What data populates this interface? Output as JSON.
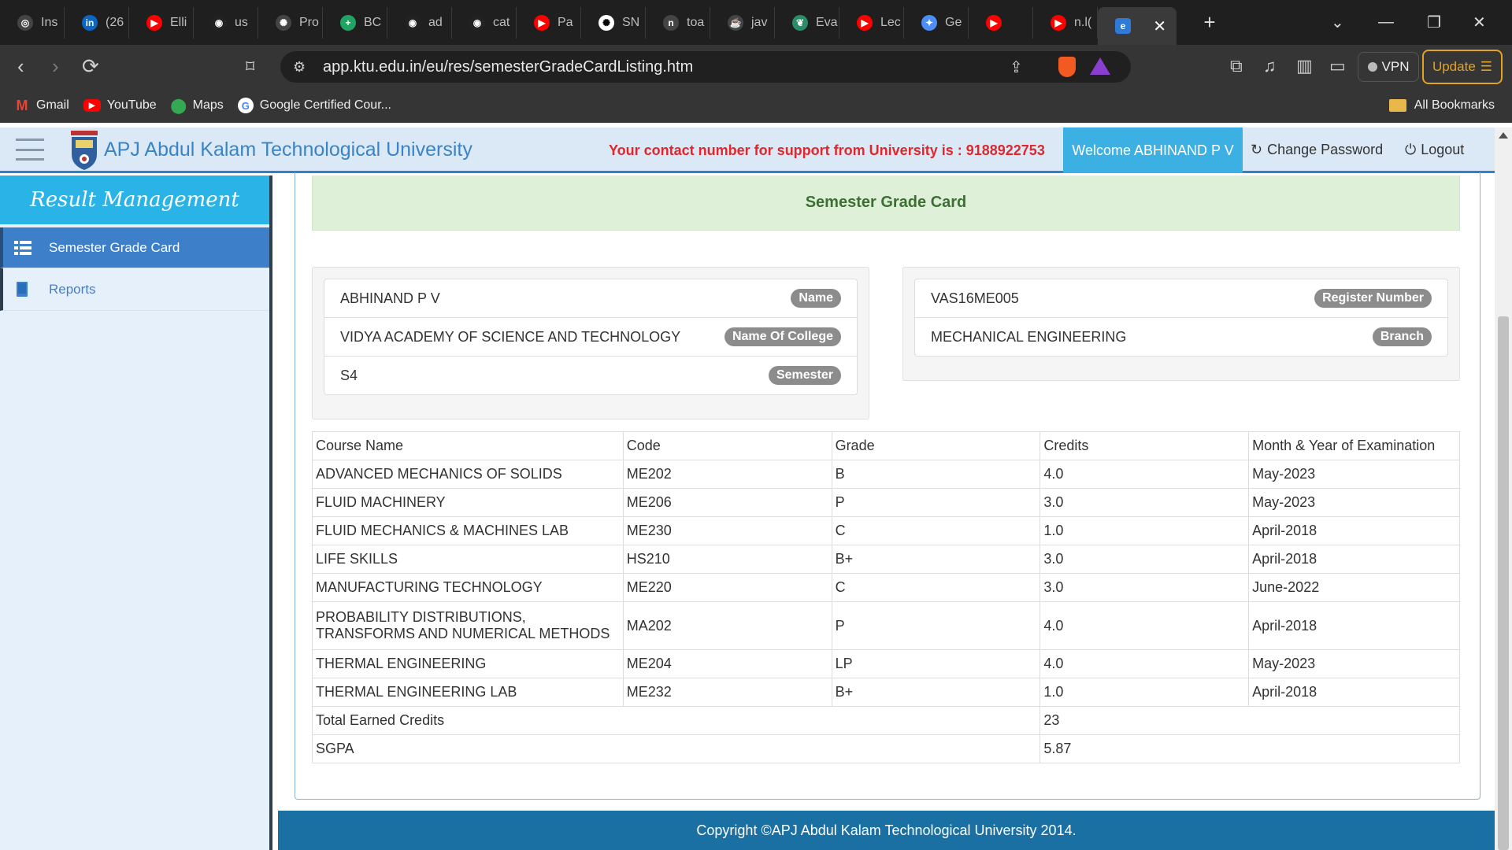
{
  "browser": {
    "tabs": [
      {
        "label": "Ins",
        "icon": "instagram-icon",
        "color": "#444"
      },
      {
        "label": "(26",
        "icon": "linkedin-icon",
        "color": "#0a66c2"
      },
      {
        "label": "Elli",
        "icon": "youtube-icon",
        "color": "#ff0000"
      },
      {
        "label": "us",
        "icon": "github-icon",
        "color": "#222"
      },
      {
        "label": "Pro",
        "icon": "openai-icon",
        "color": "#444"
      },
      {
        "label": "BC",
        "icon": "plus-icon",
        "color": "#1fa463"
      },
      {
        "label": "ad",
        "icon": "github-icon",
        "color": "#222"
      },
      {
        "label": "cat",
        "icon": "github-icon",
        "color": "#222"
      },
      {
        "label": "Pa",
        "icon": "youtube-icon",
        "color": "#ff0000"
      },
      {
        "label": "SN",
        "icon": "openai-icon",
        "color": "#fff"
      },
      {
        "label": "toa",
        "icon": "n-icon",
        "color": "#444"
      },
      {
        "label": "jav",
        "icon": "java-icon",
        "color": "#444"
      },
      {
        "label": "Eva",
        "icon": "leaf-icon",
        "color": "#2c8c6a"
      },
      {
        "label": "Lec",
        "icon": "youtube-icon",
        "color": "#ff0000"
      },
      {
        "label": "Ge",
        "icon": "gemini-icon",
        "color": "#4b8ef7"
      },
      {
        "label": "",
        "icon": "youtube-icon",
        "color": "#ff0000"
      },
      {
        "label": "n.l(",
        "icon": "youtube-icon",
        "color": "#ff0000"
      }
    ],
    "active_tab": {
      "icon": "edge-icon",
      "close": "✕"
    },
    "new_tab": "+",
    "url": "app.ktu.edu.in/eu/res/semesterGradeCardListing.htm",
    "vpn_label": "VPN",
    "update_label": "Update",
    "bookmarks": [
      {
        "label": "Gmail",
        "icon": "gmail-icon"
      },
      {
        "label": "YouTube",
        "icon": "youtube-icon"
      },
      {
        "label": "Maps",
        "icon": "maps-icon"
      },
      {
        "label": "Google Certified Cour...",
        "icon": "google-icon"
      }
    ],
    "all_bookmarks": "All Bookmarks"
  },
  "header": {
    "title": "APJ Abdul Kalam Technological University",
    "support": "Your contact number for support from University is : 9188922753",
    "welcome": "Welcome ABHINAND P V",
    "change_password": "Change Password",
    "logout": "Logout"
  },
  "sidebar": {
    "brand": "Result Management",
    "items": [
      {
        "label": "Semester Grade Card",
        "icon": "list-icon",
        "active": true
      },
      {
        "label": "Reports",
        "icon": "book-icon",
        "active": false
      }
    ]
  },
  "page": {
    "title": "Semester Grade Card",
    "student": {
      "name": "ABHINAND P V",
      "name_label": "Name",
      "college": "VIDYA ACADEMY OF SCIENCE AND TECHNOLOGY",
      "college_label": "Name Of College",
      "semester": "S4",
      "semester_label": "Semester",
      "register_number": "VAS16ME005",
      "register_label": "Register Number",
      "branch": "MECHANICAL ENGINEERING",
      "branch_label": "Branch"
    },
    "table": {
      "headers": [
        "Course Name",
        "Code",
        "Grade",
        "Credits",
        "Month & Year of Examination"
      ],
      "rows": [
        [
          "ADVANCED MECHANICS OF SOLIDS",
          "ME202",
          "B",
          "4.0",
          "May-2023"
        ],
        [
          "FLUID MACHINERY",
          "ME206",
          "P",
          "3.0",
          "May-2023"
        ],
        [
          "FLUID MECHANICS & MACHINES LAB",
          "ME230",
          "C",
          "1.0",
          "April-2018"
        ],
        [
          "LIFE SKILLS",
          "HS210",
          "B+",
          "3.0",
          "April-2018"
        ],
        [
          "MANUFACTURING TECHNOLOGY",
          "ME220",
          "C",
          "3.0",
          "June-2022"
        ],
        [
          "PROBABILITY DISTRIBUTIONS, TRANSFORMS AND NUMERICAL METHODS",
          "MA202",
          "P",
          "4.0",
          "April-2018"
        ],
        [
          "THERMAL ENGINEERING",
          "ME204",
          "LP",
          "4.0",
          "May-2023"
        ],
        [
          "THERMAL ENGINEERING LAB",
          "ME232",
          "B+",
          "1.0",
          "April-2018"
        ]
      ],
      "total_label": "Total Earned Credits",
      "total_value": "23",
      "sgpa_label": "SGPA",
      "sgpa_value": "5.87"
    }
  },
  "footer": "Copyright ©APJ Abdul Kalam Technological University 2014."
}
